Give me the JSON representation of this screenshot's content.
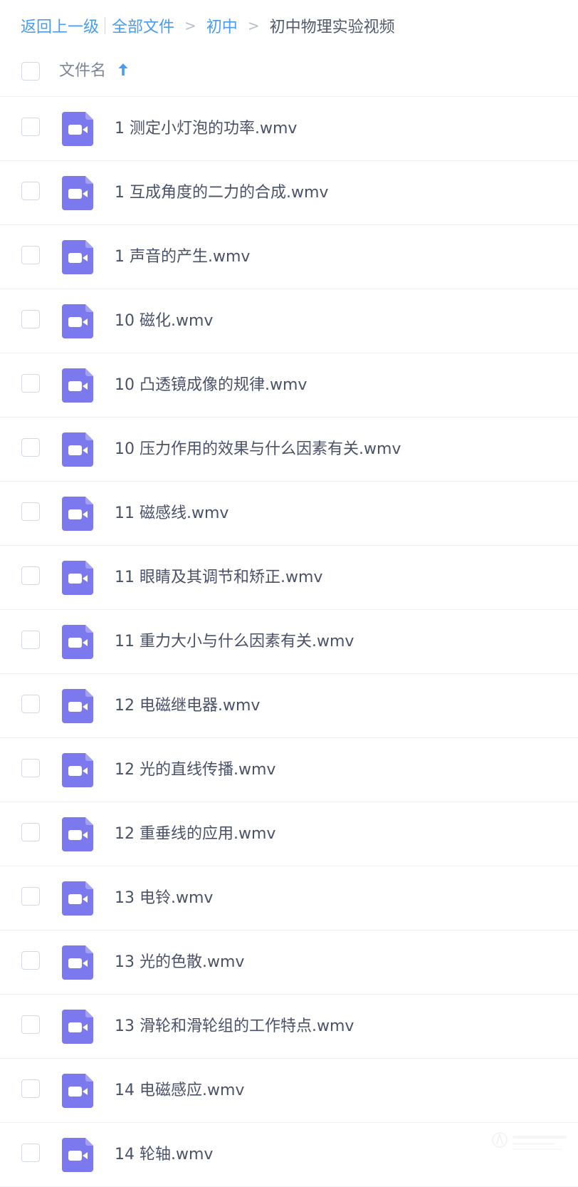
{
  "breadcrumb": {
    "back": "返回上一级",
    "all_files": "全部文件",
    "level1": "初中",
    "current": "初中物理实验视频",
    "separator": ">"
  },
  "header": {
    "column_label": "文件名",
    "sort": "ascending"
  },
  "file_icon": "video-file-icon",
  "colors": {
    "link": "#4a9cf3",
    "video_icon": "#7c79ee",
    "text": "#4b5168"
  },
  "files": [
    {
      "name": "1 测定小灯泡的功率.wmv"
    },
    {
      "name": "1 互成角度的二力的合成.wmv"
    },
    {
      "name": "1 声音的产生.wmv"
    },
    {
      "name": "10 磁化.wmv"
    },
    {
      "name": "10 凸透镜成像的规律.wmv"
    },
    {
      "name": "10 压力作用的效果与什么因素有关.wmv"
    },
    {
      "name": "11 磁感线.wmv"
    },
    {
      "name": "11 眼睛及其调节和矫正.wmv"
    },
    {
      "name": "11 重力大小与什么因素有关.wmv"
    },
    {
      "name": "12 电磁继电器.wmv"
    },
    {
      "name": "12 光的直线传播.wmv"
    },
    {
      "name": "12 重垂线的应用.wmv"
    },
    {
      "name": "13 电铃.wmv"
    },
    {
      "name": "13 光的色散.wmv"
    },
    {
      "name": "13 滑轮和滑轮组的工作特点.wmv"
    },
    {
      "name": "14 电磁感应.wmv"
    },
    {
      "name": "14 轮轴.wmv"
    }
  ]
}
